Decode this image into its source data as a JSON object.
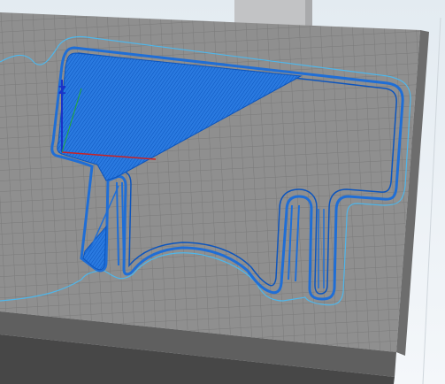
{
  "app": {
    "view": "3d-slicer-preview",
    "gizmo": {
      "z_label": "Z"
    },
    "colors": {
      "background_top": "#e6edf2",
      "background_side": "#f2f6f9",
      "bed_surface": "#8d8d8d",
      "bed_grid": "#7b7b7b",
      "bed_edge": "#5d5d5d",
      "bed_edge_dark": "#3f3f3f",
      "support_beam": "#bfc0c2",
      "toolpath_blue": "#1f6ed6",
      "toolpath_blue_dark": "#0c4fb4",
      "skirt_line": "#4bb3e8",
      "axis_z": "#1a33c9",
      "axis_x": "#cc2222",
      "axis_y": "#22aa33"
    },
    "icons": [
      "z-axis-gizmo-icon"
    ]
  }
}
